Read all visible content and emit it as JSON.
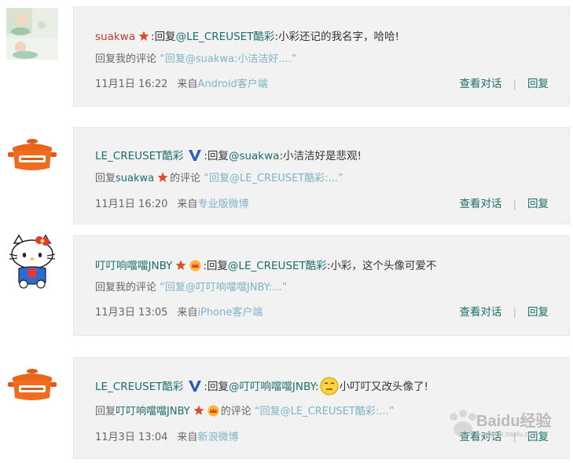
{
  "comments": [
    {
      "user": "suakwa",
      "colon": ":",
      "reply_prefix": "回复",
      "mention": "@LE_CREUSET酷彩",
      "text": ":小彩还记的我名字，哈哈!",
      "line2_prefix": "回复我的评论",
      "quote": "“回复@suakwa:小洁洁好....”",
      "time": "11月1日 16:22",
      "from_prefix": "来自",
      "source": "Android客户端",
      "view_convo": "查看对话",
      "reply": "回复",
      "sep": "|"
    },
    {
      "user": "LE_CREUSET酷彩",
      "colon": ":",
      "reply_prefix": "回复",
      "mention": "@suakwa",
      "text": ":小洁洁好是悲观!",
      "line2_prefix": "回复",
      "line2_user": "suakwa",
      "line2_suffix": "的评论",
      "quote": "“回复@LE_CREUSET酷彩:...”",
      "time": "11月1日 16:20",
      "from_prefix": "来自",
      "source": "专业版微博",
      "view_convo": "查看对话",
      "reply": "回复",
      "sep": "|"
    },
    {
      "user": "叮叮响噹噹JNBY",
      "colon": ":",
      "reply_prefix": "回复",
      "mention": "@LE_CREUSET酷彩",
      "text": ":小彩，这个头像可爱不",
      "line2_prefix": "回复我的评论",
      "quote": "“回复@叮叮响噹噹JNBY:...”",
      "time": "11月3日 13:05",
      "from_prefix": "来自",
      "source": "iPhone客户端",
      "view_convo": "查看对话",
      "reply": "回复",
      "sep": "|"
    },
    {
      "user": "LE_CREUSET酷彩",
      "colon": ":",
      "reply_prefix": "回复",
      "mention": "@叮叮响噹噹JNBY",
      "text_before": ":",
      "text": "小叮叮又改头像了!",
      "line2_prefix": "回复",
      "line2_user": "叮叮响噹噹JNBY",
      "line2_suffix": "的评论",
      "quote": "“回复@LE_CREUSET酷彩:...”",
      "time": "11月3日 13:04",
      "from_prefix": "来自",
      "source": "新浪微博",
      "view_convo": "查看对话",
      "reply": "回复",
      "sep": "|"
    }
  ],
  "watermark": {
    "text": "Baidu经验",
    "sub": "jingyan.baidu.com"
  },
  "colors": {
    "username_red": "#c0392b",
    "link_teal": "#1a6e6a",
    "quote_blue": "#7cb3c7",
    "box_bg": "#f2f2f2"
  },
  "icons": [
    "star-badge-icon",
    "verified-v-icon",
    "crown-icon",
    "emoji-face-icon",
    "pot-logo-icon",
    "hello-kitty-avatar"
  ]
}
